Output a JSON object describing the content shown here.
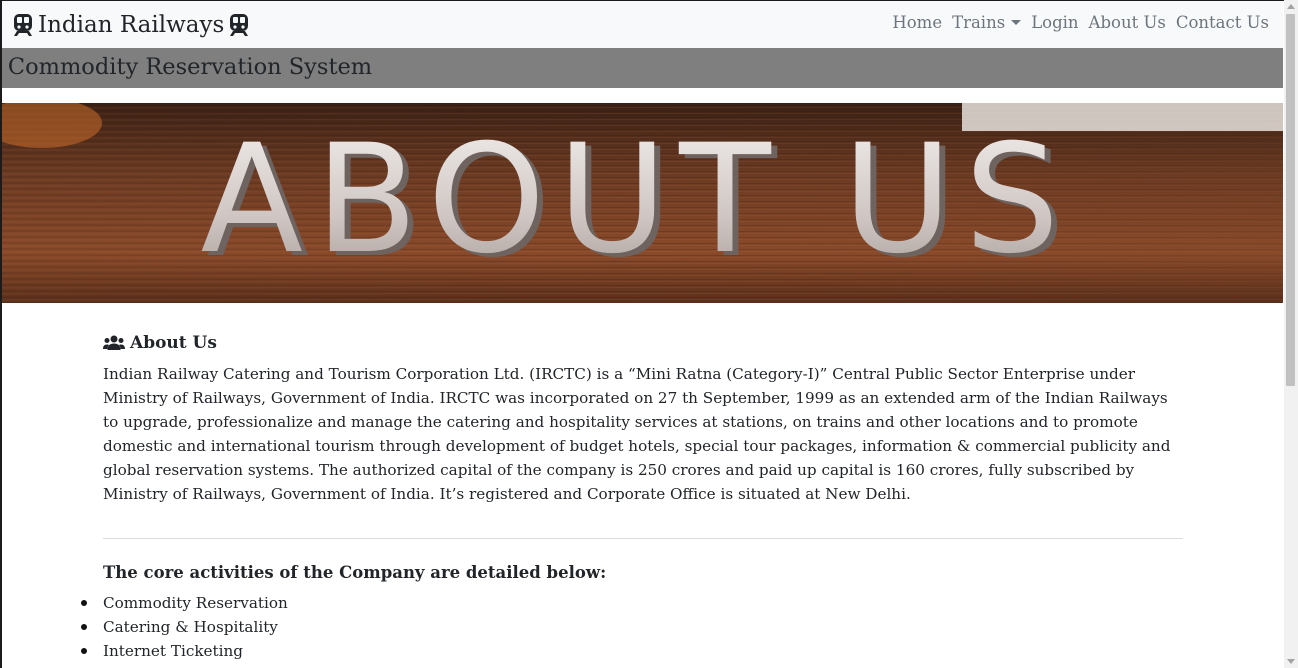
{
  "navbar": {
    "brand": "Indian Railways",
    "brand_icon": "train-icon",
    "links": {
      "home": "Home",
      "trains": "Trains",
      "login": "Login",
      "about": "About Us",
      "contact": "Contact Us"
    }
  },
  "marquee": {
    "text": "y Commodity Reservation System"
  },
  "banner": {
    "text": "ABOUT US",
    "background_color": "#6b3a22"
  },
  "about": {
    "heading": "About Us",
    "heading_icon": "users-icon",
    "paragraph": "Indian Railway Catering and Tourism Corporation Ltd. (IRCTC) is a “Mini Ratna (Category-I)” Central Public Sector Enterprise under Ministry of Railways, Government of India. IRCTC was incorporated on 27 th September, 1999 as an extended arm of the Indian Railways to upgrade, professionalize and manage the catering and hospitality services at stations, on trains and other locations and to promote domestic and international tourism through development of budget hotels, special tour packages, information & commercial publicity and global reservation systems. The authorized capital of the company is 250 crores and paid up capital is 160 crores, fully subscribed by Ministry of Railways, Government of India. It’s registered and Corporate Office is situated at New Delhi."
  },
  "core": {
    "title": "The core activities of the Company are detailed below:",
    "items": [
      "Commodity Reservation",
      "Catering & Hospitality",
      "Internet Ticketing"
    ]
  }
}
